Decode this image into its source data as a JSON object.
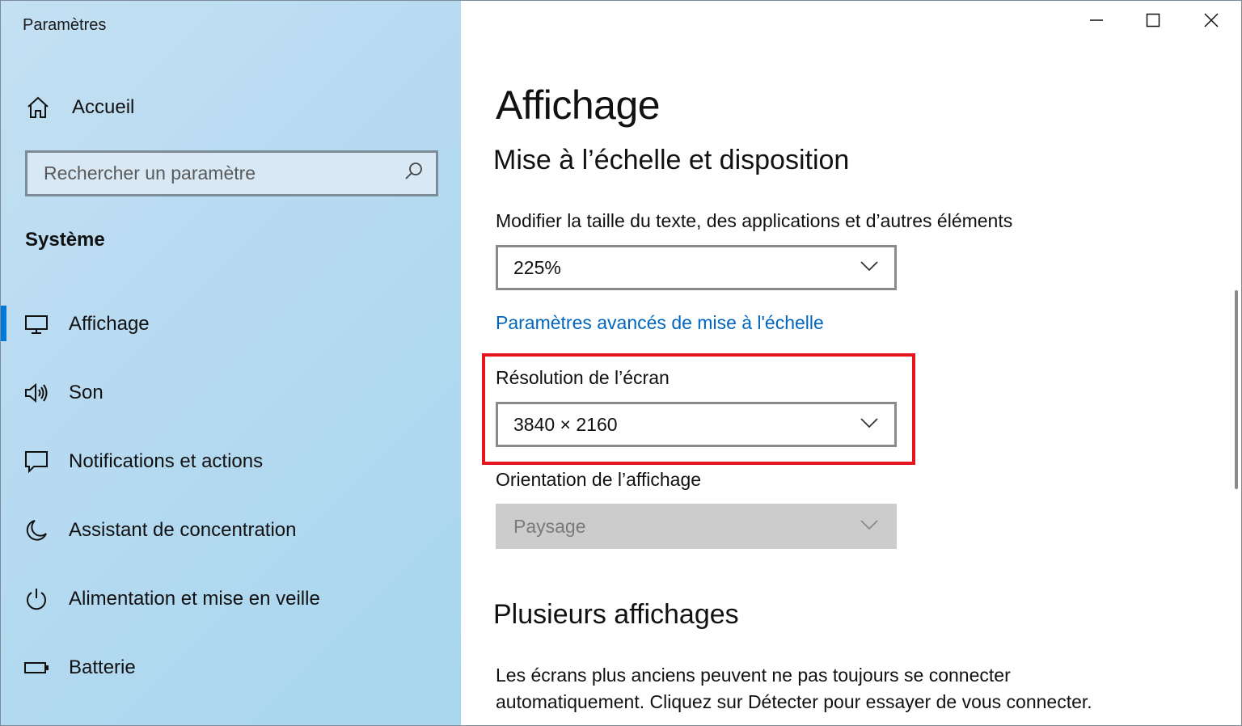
{
  "window": {
    "title": "Paramètres",
    "controls": {
      "minimize": "minimize",
      "maximize": "maximize",
      "close": "close"
    }
  },
  "sidebar": {
    "home_label": "Accueil",
    "search": {
      "placeholder": "Rechercher un paramètre"
    },
    "section_title": "Système",
    "items": [
      {
        "label": "Affichage",
        "icon": "monitor-icon",
        "active": true
      },
      {
        "label": "Son",
        "icon": "speaker-icon",
        "active": false
      },
      {
        "label": "Notifications et actions",
        "icon": "notification-icon",
        "active": false
      },
      {
        "label": "Assistant de concentration",
        "icon": "moon-icon",
        "active": false
      },
      {
        "label": "Alimentation et mise en veille",
        "icon": "power-icon",
        "active": false
      },
      {
        "label": "Batterie",
        "icon": "battery-icon",
        "active": false
      }
    ]
  },
  "main": {
    "page_title": "Affichage",
    "scale_heading": "Mise à l’échelle et disposition",
    "scale_label": "Modifier la taille du texte, des applications et d’autres éléments",
    "scale_value": "225%",
    "advanced_link": "Paramètres avancés de mise à l'échelle",
    "resolution_label": "Résolution de l’écran",
    "resolution_value": "3840 × 2160",
    "orientation_label": "Orientation de l’affichage",
    "orientation_value": "Paysage",
    "multi_heading": "Plusieurs affichages",
    "multi_desc": "Les écrans plus anciens peuvent ne pas toujours se connecter automatiquement. Cliquez sur Détecter pour essayer de vous connecter."
  },
  "colors": {
    "accent": "#0078d7",
    "link": "#0067c0",
    "highlight": "#e8141d",
    "sidebar_bg": "#b6daf1"
  }
}
